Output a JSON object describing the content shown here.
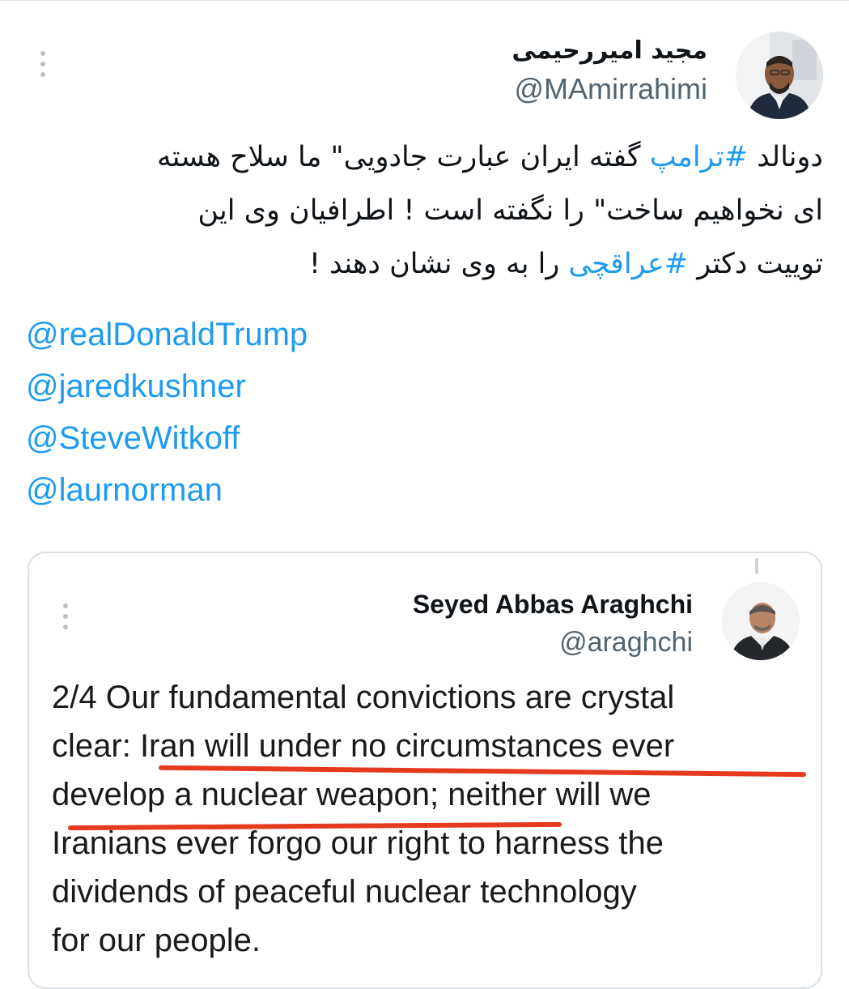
{
  "tweet": {
    "author": {
      "display_name": "مجید امیررحیمی",
      "handle": "@MAmirrahimi",
      "avatar_icon": "person-portrait-icon"
    },
    "body": {
      "line1_pre": "دونالد ",
      "hashtag1": "#ترامپ",
      "line1_post": " گفته ایران عبارت جادویی\" ما سلاح هسته",
      "line2": "ای نخواهیم ساخت\" را نگفته است ! اطرافیان وی این",
      "line3_pre": "توییت دکتر ",
      "hashtag2": "#عراقچی",
      "line3_post": " را به وی نشان دهند !"
    },
    "mentions": [
      "@realDonaldTrump",
      "@jaredkushner",
      "@SteveWitkoff",
      "@laurnorman"
    ],
    "menu_icon": "more-vertical-icon"
  },
  "quoted_tweet": {
    "author": {
      "display_name": "Seyed Abbas Araghchi",
      "handle": "@araghchi",
      "avatar_icon": "person-portrait-icon"
    },
    "text": {
      "l1": "2/4 Our fundamental convictions are crystal",
      "l2_pre": "clear: ",
      "l2_rest": "Iran will under no circumstances ever",
      "l3": "develop a nuclear weapon; neither will we",
      "l4": "Iranians ever forgo our right to harness the",
      "l5": "dividends of peaceful nuclear technology",
      "l6": "for our people."
    },
    "highlight_color": "#e63a1f",
    "menu_icon": "more-vertical-icon"
  },
  "colors": {
    "link": "#1d9bf0",
    "text": "#0f1419",
    "secondary": "#536471"
  }
}
